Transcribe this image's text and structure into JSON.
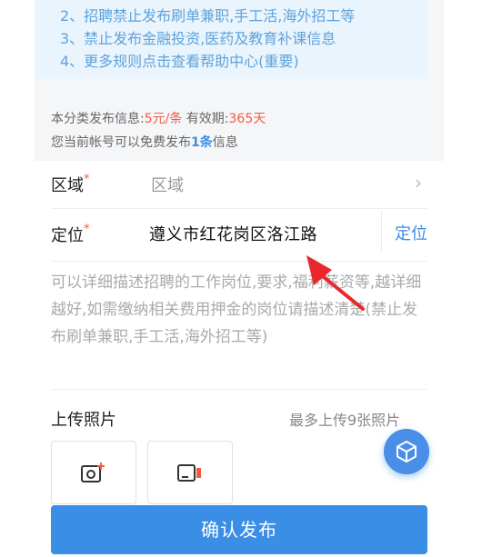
{
  "rules": {
    "line2": "2、招聘禁止发布刷单兼职,手工活,海外招工等",
    "line3": "3、禁止发布金融投资,医药及教育补课信息",
    "line4": "4、更多规则点击查看帮助中心(重要)"
  },
  "publish_info": {
    "prefix": "本分类发布信息:",
    "price": "5元/条",
    "validity_label": "有效期:",
    "validity_value": "365天",
    "free_prefix": "您当前帐号可以免费发布",
    "free_count": "1条",
    "free_suffix": "信息"
  },
  "form": {
    "region_label": "区域",
    "region_required": "*",
    "region_value": "区域",
    "location_label": "定位",
    "location_required": "*",
    "location_value": "遵义市红花岗区洛江路",
    "locate_button": "定位",
    "description_placeholder": "可以详细描述招聘的工作岗位,要求,福利薪资等,越详细越好,如需缴纳相关费用押金的岗位请描述清楚(禁止发布刷单兼职,手工活,海外招工等)",
    "upload_label": "上传照片",
    "upload_hint": "最多上传9张照片"
  },
  "submit": {
    "label": "确认发布"
  },
  "colors": {
    "accent": "#3a8ee6",
    "required": "#f05a4a",
    "annotation_arrow": "#e8282a"
  },
  "icons": {
    "region_chevron": "chevron-right-icon",
    "photo_tile": "add-photo-icon",
    "video_tile": "add-video-icon",
    "fab": "cube-icon"
  }
}
